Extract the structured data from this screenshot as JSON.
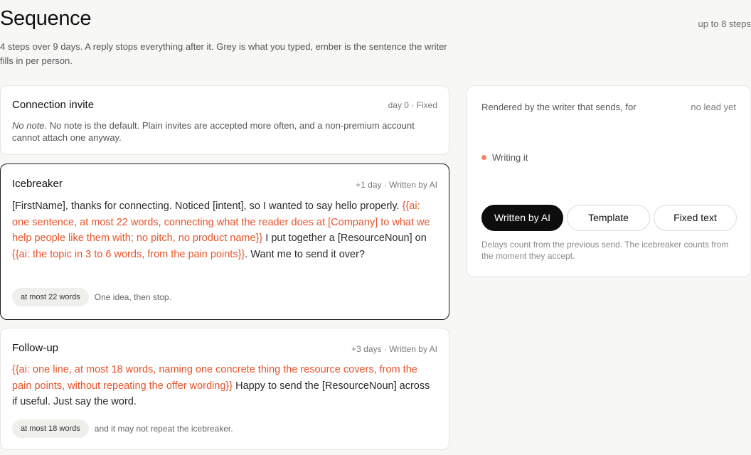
{
  "header": {
    "title": "Sequence",
    "meta": "up to 8 steps",
    "subtitle": "4 steps over 9 days. A reply stops everything after it. Grey is what you typed, ember is the sentence the writer fills in per person."
  },
  "steps": [
    {
      "title": "Connection invite",
      "meta": "day 0 · Fixed",
      "note_em": "No note.",
      "note_rest": " No note is the default. Plain invites are accepted more often, and a non-premium account cannot attach one anyway."
    },
    {
      "title": "Icebreaker",
      "meta": "+1 day · Written by AI",
      "segments": [
        "[FirstName], thanks for connecting. Noticed [intent], so I wanted to say hello properly. ",
        "{{ai: one sentence, at most 22 words, connecting what the reader does at [Company] to what we help people like them with; no pitch, no product name}}",
        " I put together a [ResourceNoun] on ",
        "{{ai: the topic in 3 to 6 words, from the pain points}}",
        ". Want me to send it over?"
      ],
      "chip": "at most 22 words",
      "chip_note": "One idea, then stop."
    },
    {
      "title": "Follow-up",
      "meta": "+3 days · Written by AI",
      "segments": [
        "{{ai: one line, at most 18 words, naming one concrete thing the resource covers, from the pain points, without repeating the offer wording}}",
        " Happy to send the [ResourceNoun] across if useful. Just say the word."
      ],
      "chip": "at most 18 words",
      "chip_note": "and it may not repeat the icebreaker."
    }
  ],
  "preview": {
    "label": "Rendered by the writer that sends, for",
    "lead": "no lead yet",
    "status": "Writing it",
    "modes": [
      "Written by AI",
      "Template",
      "Fixed text"
    ],
    "active_mode": "Written by AI",
    "note": "Delays count from the previous send. The icebreaker counts from the moment they accept."
  },
  "colors": {
    "ember": "#e8542b",
    "dot": "#ef8468"
  }
}
